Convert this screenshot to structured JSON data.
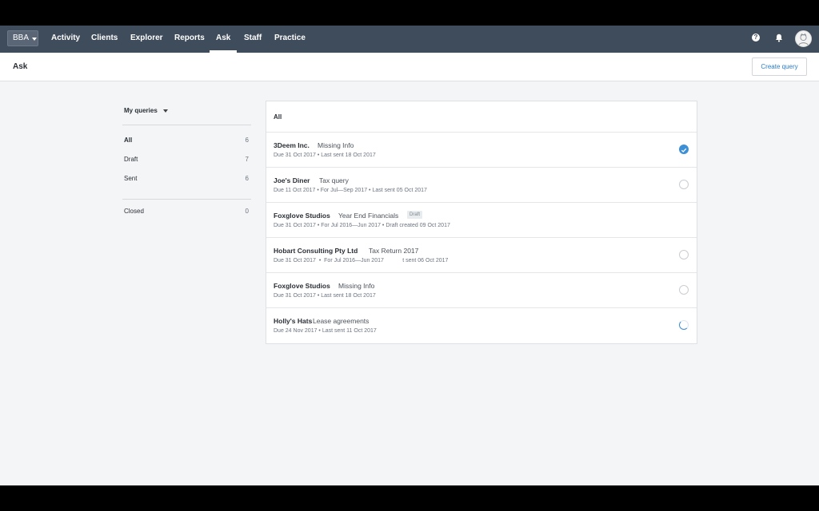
{
  "nav": {
    "org_label": "BBA",
    "links": [
      "Activity",
      "Clients",
      "Explorer",
      "Reports",
      "Ask",
      "Staff",
      "Practice"
    ],
    "active": "Ask",
    "help_glyph": "?"
  },
  "subheader": {
    "title": "Ask",
    "create_label": "Create query"
  },
  "sidebar": {
    "filter_label": "My queries",
    "items": [
      {
        "label": "All",
        "count": "6"
      },
      {
        "label": "Draft",
        "count": "7"
      },
      {
        "label": "Sent",
        "count": "6"
      },
      {
        "label": "Closed",
        "count": "0"
      }
    ],
    "active": "All"
  },
  "list": {
    "header": "All",
    "rows": [
      {
        "client": "3Deem Inc.",
        "query": "Missing Info",
        "meta": "Due 31 Oct 2017  •  Last sent 18 Oct 2017",
        "badge": "",
        "status": "checked"
      },
      {
        "client": "Joe's Diner",
        "query": "Tax query",
        "meta": "Due 11 Oct 2017  •  For Jul—Sep 2017  •  Last sent 05 Oct 2017",
        "badge": "",
        "status": "empty"
      },
      {
        "client": "Foxglove Studios",
        "query": "Year End Financials",
        "meta": "Due 31 Oct 2017  •  For Jul 2016—Jun 2017  •  Draft created 09 Oct 2017",
        "badge": "Draft",
        "status": "none"
      },
      {
        "client": "Hobart Consulting Pty Ltd",
        "query": "Tax Return 2017",
        "meta": "Due 31 Oct 2017  •  For Jul 2016—Jun 2017            t sent 06 Oct 2017",
        "badge": "",
        "status": "empty"
      },
      {
        "client": "Foxglove Studios",
        "query": "Missing Info",
        "meta": "Due 31 Oct 2017  •  Last sent 18 Oct 2017",
        "badge": "",
        "status": "empty"
      },
      {
        "client": "Holly's Hats",
        "query": "Lease agreements",
        "meta": "Due 24 Nov 2017  •  Last sent 11 Oct 2017",
        "badge": "",
        "status": "progress"
      }
    ]
  },
  "colors": {
    "nav_bg": "#3f4c5c",
    "accent": "#3d8fd6",
    "link": "#2d7bc4"
  },
  "icons": [
    "help-icon",
    "bell-icon",
    "avatar",
    "chevron-down-icon",
    "check-icon"
  ]
}
